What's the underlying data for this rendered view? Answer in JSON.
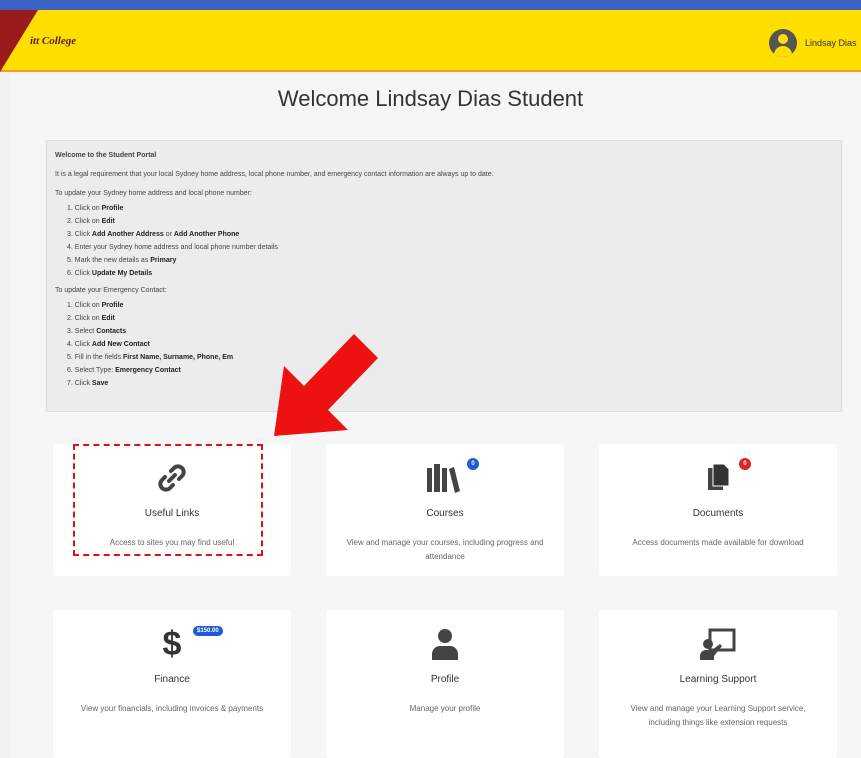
{
  "header": {
    "logo_text": "itt College",
    "user_name": "Lindsay Dias"
  },
  "page": {
    "welcome": "Welcome Lindsay Dias Student"
  },
  "info": {
    "title": "Welcome to the Student Portal",
    "intro": "It is a legal requirement that your local Sydney home address, local phone number, and emergency contact information are always up to date.",
    "address_heading": "To update your Sydney home address and local phone number:",
    "address_steps": [
      {
        "pre": "1. Click on ",
        "bold": "Profile",
        "post": ""
      },
      {
        "pre": "2. Click on ",
        "bold": "Edit",
        "post": ""
      },
      {
        "pre": "3. Click ",
        "bold": "Add Another Address",
        "post": " or ",
        "bold2": "Add Another Phone"
      },
      {
        "pre": "4. Enter your Sydney home address and local phone number details",
        "bold": "",
        "post": ""
      },
      {
        "pre": "5. Mark the new details as ",
        "bold": "Primary",
        "post": ""
      },
      {
        "pre": "6. Click ",
        "bold": "Update My Details",
        "post": ""
      }
    ],
    "contact_heading": "To update your Emergency Contact:",
    "contact_steps": [
      {
        "pre": "1. Click on ",
        "bold": "Profile",
        "post": ""
      },
      {
        "pre": "2. Click on ",
        "bold": "Edit",
        "post": ""
      },
      {
        "pre": "3. Select ",
        "bold": "Contacts",
        "post": ""
      },
      {
        "pre": "4. Click ",
        "bold": "Add New Contact",
        "post": ""
      },
      {
        "pre": "5. Fill in the fields ",
        "bold": "First Name, Surname, Phone, Em",
        "post": ""
      },
      {
        "pre": "6. Select Type: ",
        "bold": "Emergency Contact",
        "post": ""
      },
      {
        "pre": "7. Click ",
        "bold": "Save",
        "post": ""
      }
    ]
  },
  "cards": {
    "useful_links": {
      "title": "Useful Links",
      "desc": "Access to sites you may find useful"
    },
    "courses": {
      "title": "Courses",
      "desc": "View and manage your courses, including progress and attendance",
      "badge": "0"
    },
    "documents": {
      "title": "Documents",
      "desc": "Access documents made available for download",
      "badge": "0"
    },
    "finance": {
      "title": "Finance",
      "desc": "View your financials, including invoices & payments",
      "badge": "$150.00"
    },
    "profile": {
      "title": "Profile",
      "desc": "Manage your profile"
    },
    "learning_support": {
      "title": "Learning Support",
      "desc": "View and manage your Learning Support service, including things like extension requests"
    }
  },
  "colors": {
    "header": "#ffde00",
    "top_strip": "#3b63c4",
    "arrow": "#e01010",
    "badge_blue": "#1f5bd6",
    "badge_red": "#e02424"
  },
  "icons": {
    "useful_links": "link-icon",
    "courses": "books-icon",
    "documents": "documents-icon",
    "finance": "dollar-icon",
    "profile": "person-icon",
    "learning_support": "presentation-icon"
  }
}
